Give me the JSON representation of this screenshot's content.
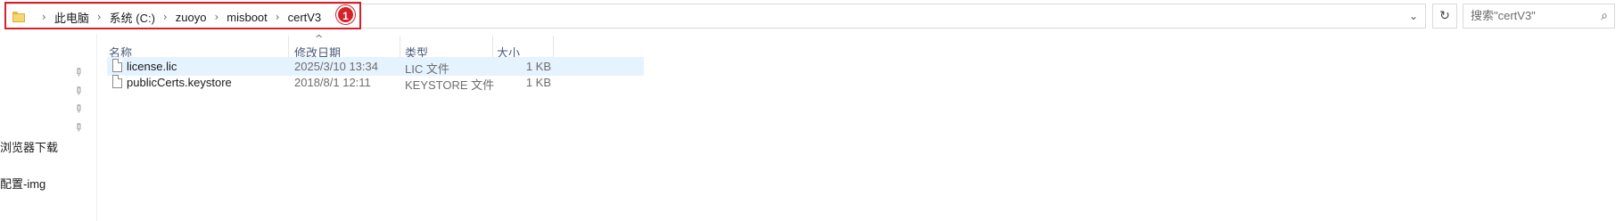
{
  "address_bar": {
    "path": [
      "此电脑",
      "系统 (C:)",
      "zuoyo",
      "misboot",
      "certV3"
    ],
    "annotation_badge": "1"
  },
  "search": {
    "placeholder": "搜索\"certV3\""
  },
  "nav_pane": {
    "items": [
      "浏览器下载",
      "",
      "配置-img"
    ]
  },
  "columns": {
    "name": "名称",
    "date": "修改日期",
    "type": "类型",
    "size": "大小"
  },
  "files": [
    {
      "name": "license.lic",
      "date": "2025/3/10 13:34",
      "type": "LIC 文件",
      "size": "1 KB",
      "selected": true
    },
    {
      "name": "publicCerts.keystore",
      "date": "2018/8/1 12:11",
      "type": "KEYSTORE 文件",
      "size": "1 KB",
      "selected": false
    }
  ],
  "colors": {
    "annotation": "#d6212a",
    "selection": "#e5f3ff",
    "header_text": "#4a5a7a"
  },
  "icons": [
    "folder-icon",
    "chevron-right-icon",
    "chevron-down-icon",
    "refresh-icon",
    "search-icon",
    "pin-icon",
    "file-icon",
    "sort-up-icon"
  ]
}
